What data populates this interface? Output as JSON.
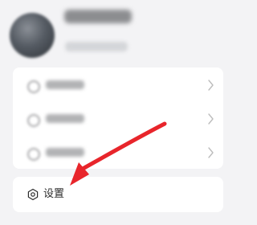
{
  "menu": {
    "settings_label": "设置"
  },
  "icons": {
    "settings": "settings-icon",
    "chevron": "chevron-right-icon",
    "annotation": "red-arrow-pointing-to-settings"
  },
  "colors": {
    "background": "#f3f3f5",
    "card": "#ffffff",
    "text": "#2b2b2b",
    "annotation_red": "#e8252b"
  }
}
